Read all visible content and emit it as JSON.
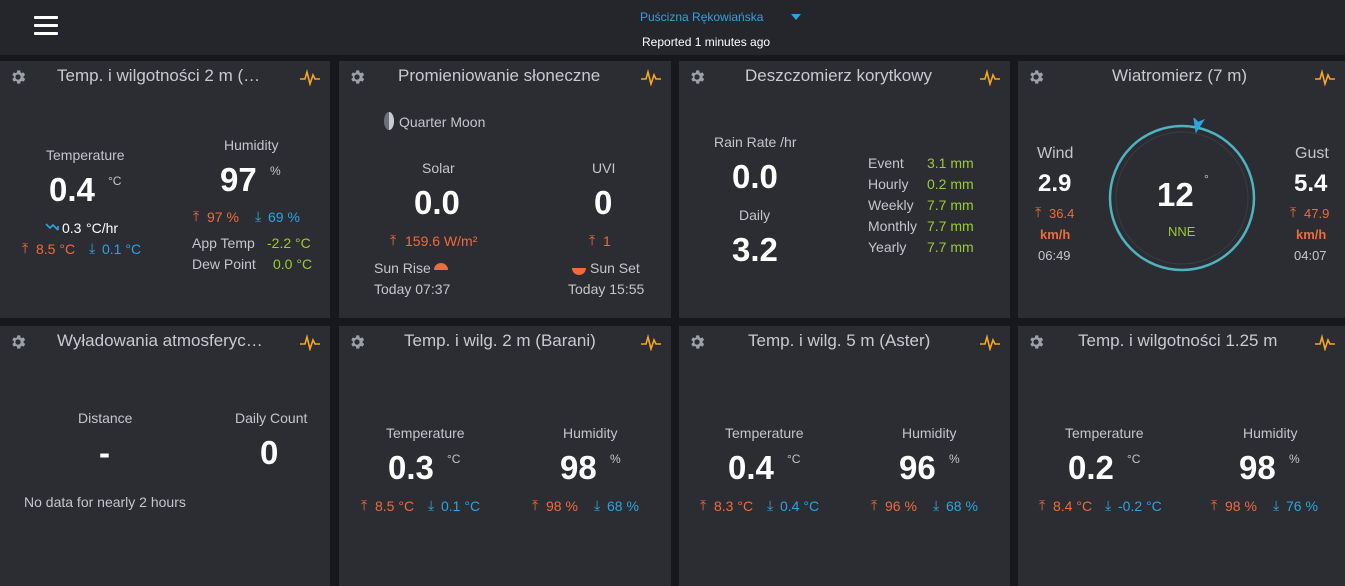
{
  "header": {
    "station": "Puścizna Rękowiańska",
    "reported": "Reported 1 minutes ago"
  },
  "cards": {
    "temp_hum_2m": {
      "title": "Temp. i wilgotności 2 m (…",
      "temp_label": "Temperature",
      "temp_value": "0.4",
      "temp_unit": "°C",
      "trend_value": "0.3",
      "trend_unit": "°C/hr",
      "temp_high": "8.5 °C",
      "temp_low": "0.1 °C",
      "hum_label": "Humidity",
      "hum_value": "97",
      "hum_unit": "%",
      "hum_high": "97 %",
      "hum_low": "69 %",
      "app_temp_label": "App Temp",
      "app_temp_value": "-2.2 °C",
      "dew_label": "Dew Point",
      "dew_value": "0.0 °C"
    },
    "solar": {
      "title": "Promieniowanie słoneczne",
      "moon": "Quarter Moon",
      "solar_label": "Solar",
      "solar_value": "0.0",
      "solar_high": "159.6 W/m²",
      "uvi_label": "UVI",
      "uvi_value": "0",
      "uvi_high": "1",
      "sunrise_label": "Sun Rise",
      "sunrise_time": "Today 07:37",
      "sunset_label": "Sun Set",
      "sunset_time": "Today 15:55"
    },
    "rain": {
      "title": "Deszczomierz korytkowy",
      "rate_label": "Rain Rate /hr",
      "rate_value": "0.0",
      "daily_label": "Daily",
      "daily_value": "3.2",
      "rows": [
        {
          "label": "Event",
          "value": "3.1 mm"
        },
        {
          "label": "Hourly",
          "value": "0.2 mm"
        },
        {
          "label": "Weekly",
          "value": "7.7 mm"
        },
        {
          "label": "Monthly",
          "value": "7.7 mm"
        },
        {
          "label": "Yearly",
          "value": "7.7 mm"
        }
      ]
    },
    "wind": {
      "title": "Wiatromierz (7 m)",
      "wind_label": "Wind",
      "wind_value": "2.9",
      "wind_high": "36.4",
      "wind_unit": "km/h",
      "wind_time": "06:49",
      "gust_label": "Gust",
      "gust_value": "5.4",
      "gust_high": "47.9",
      "gust_unit": "km/h",
      "gust_time": "04:07",
      "direction_degrees": "12",
      "degree_symbol": "°",
      "direction_cardinal": "NNE"
    },
    "lightning": {
      "title": "Wyładowania atmosferyc…",
      "distance_label": "Distance",
      "distance_value": "-",
      "count_label": "Daily Count",
      "count_value": "0",
      "note": "No data for nearly 2 hours"
    },
    "temp_barani": {
      "title": "Temp. i wilg. 2 m (Barani)",
      "temp_label": "Temperature",
      "temp_value": "0.3",
      "temp_unit": "°C",
      "temp_high": "8.5 °C",
      "temp_low": "0.1 °C",
      "hum_label": "Humidity",
      "hum_value": "98",
      "hum_unit": "%",
      "hum_high": "98 %",
      "hum_low": "68 %"
    },
    "temp_aster": {
      "title": "Temp. i wilg. 5 m (Aster)",
      "temp_label": "Temperature",
      "temp_value": "0.4",
      "temp_unit": "°C",
      "temp_high": "8.3 °C",
      "temp_low": "0.4 °C",
      "hum_label": "Humidity",
      "hum_value": "96",
      "hum_unit": "%",
      "hum_high": "96 %",
      "hum_low": "68 %"
    },
    "temp_125m": {
      "title": "Temp. i wilgotności 1.25 m",
      "temp_label": "Temperature",
      "temp_value": "0.2",
      "temp_unit": "°C",
      "temp_high": "8.4 °C",
      "temp_low": "-0.2 °C",
      "hum_label": "Humidity",
      "hum_value": "98",
      "hum_unit": "%",
      "hum_high": "98 %",
      "hum_low": "76 %"
    }
  },
  "icons": {
    "menu": "hamburger-menu-icon",
    "settings": "gear-icon",
    "chart": "pulse-chart-icon",
    "high": "arrow-up-icon",
    "low": "arrow-down-icon",
    "moon": "moon-icon",
    "sunrise": "sunrise-icon",
    "sunset": "sunset-icon",
    "trend": "trend-down-icon",
    "compass": "compass-icon"
  },
  "colors": {
    "background": "#17181c",
    "card": "#2b2d33",
    "topbar": "#25262c",
    "accent": "#2ba4e0",
    "high": "#f06a3c",
    "low": "#2ba4e0",
    "green": "#9ccc30",
    "chart_icon": "#f5a623",
    "compass": "#4fb3bf"
  }
}
